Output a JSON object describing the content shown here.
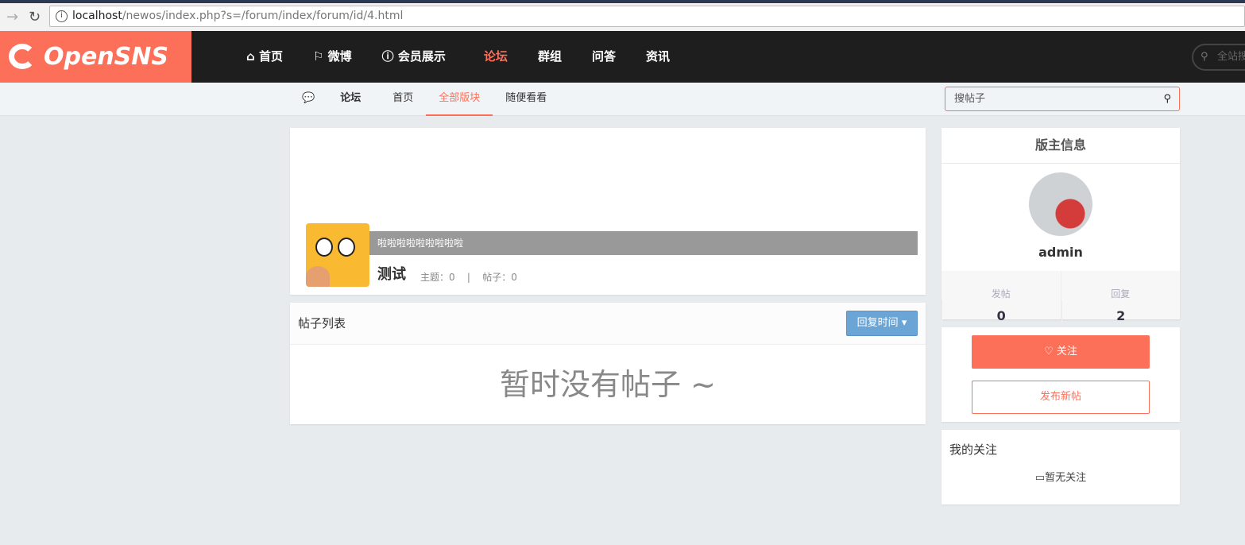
{
  "browser": {
    "url_host": "localhost",
    "url_path": "/newos/index.php?s=/forum/index/forum/id/4.html"
  },
  "header": {
    "logo": "OpenSNS",
    "nav": [
      {
        "label": "首页",
        "icon": "home-icon"
      },
      {
        "label": "微博",
        "icon": "flag-icon"
      },
      {
        "label": "会员展示",
        "icon": "question-circle-icon"
      },
      {
        "label": "论坛"
      },
      {
        "label": "群组"
      },
      {
        "label": "问答"
      },
      {
        "label": "资讯"
      }
    ],
    "active": "论坛",
    "search_placeholder": "全站搜"
  },
  "subnav": {
    "brand": "论坛",
    "items": [
      "首页",
      "全部版块",
      "随便看看"
    ],
    "active": "全部版块",
    "search_placeholder": "搜帖子"
  },
  "forum": {
    "description": "啦啦啦啦啦啦啦啦啦",
    "name": "测试",
    "topics_label": "主题：0",
    "posts_label": "帖子：0",
    "separator": "|"
  },
  "post_list": {
    "title": "帖子列表",
    "sort_label": "回复时间",
    "empty": "暂时没有帖子 ~"
  },
  "moderator": {
    "title": "版主信息",
    "name": "admin",
    "stats": [
      {
        "label": "发帖",
        "value": "0"
      },
      {
        "label": "回复",
        "value": "2"
      }
    ]
  },
  "actions": {
    "follow": "关注",
    "new_post": "发布新帖"
  },
  "my_follow": {
    "title": "我的关注",
    "empty": "暂无关注"
  },
  "colors": {
    "accent": "#fc705a",
    "topbar": "#1e1e1e",
    "sort_button": "#6aa5d6"
  }
}
